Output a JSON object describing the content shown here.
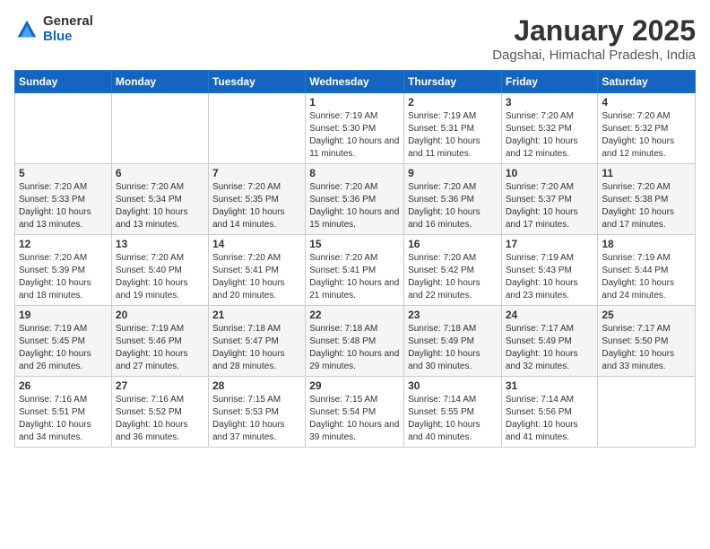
{
  "header": {
    "logo_general": "General",
    "logo_blue": "Blue",
    "title": "January 2025",
    "location": "Dagshai, Himachal Pradesh, India"
  },
  "days_of_week": [
    "Sunday",
    "Monday",
    "Tuesday",
    "Wednesday",
    "Thursday",
    "Friday",
    "Saturday"
  ],
  "weeks": [
    [
      {
        "day": "",
        "info": ""
      },
      {
        "day": "",
        "info": ""
      },
      {
        "day": "",
        "info": ""
      },
      {
        "day": "1",
        "info": "Sunrise: 7:19 AM\nSunset: 5:30 PM\nDaylight: 10 hours and 11 minutes."
      },
      {
        "day": "2",
        "info": "Sunrise: 7:19 AM\nSunset: 5:31 PM\nDaylight: 10 hours and 11 minutes."
      },
      {
        "day": "3",
        "info": "Sunrise: 7:20 AM\nSunset: 5:32 PM\nDaylight: 10 hours and 12 minutes."
      },
      {
        "day": "4",
        "info": "Sunrise: 7:20 AM\nSunset: 5:32 PM\nDaylight: 10 hours and 12 minutes."
      }
    ],
    [
      {
        "day": "5",
        "info": "Sunrise: 7:20 AM\nSunset: 5:33 PM\nDaylight: 10 hours and 13 minutes."
      },
      {
        "day": "6",
        "info": "Sunrise: 7:20 AM\nSunset: 5:34 PM\nDaylight: 10 hours and 13 minutes."
      },
      {
        "day": "7",
        "info": "Sunrise: 7:20 AM\nSunset: 5:35 PM\nDaylight: 10 hours and 14 minutes."
      },
      {
        "day": "8",
        "info": "Sunrise: 7:20 AM\nSunset: 5:36 PM\nDaylight: 10 hours and 15 minutes."
      },
      {
        "day": "9",
        "info": "Sunrise: 7:20 AM\nSunset: 5:36 PM\nDaylight: 10 hours and 16 minutes."
      },
      {
        "day": "10",
        "info": "Sunrise: 7:20 AM\nSunset: 5:37 PM\nDaylight: 10 hours and 17 minutes."
      },
      {
        "day": "11",
        "info": "Sunrise: 7:20 AM\nSunset: 5:38 PM\nDaylight: 10 hours and 17 minutes."
      }
    ],
    [
      {
        "day": "12",
        "info": "Sunrise: 7:20 AM\nSunset: 5:39 PM\nDaylight: 10 hours and 18 minutes."
      },
      {
        "day": "13",
        "info": "Sunrise: 7:20 AM\nSunset: 5:40 PM\nDaylight: 10 hours and 19 minutes."
      },
      {
        "day": "14",
        "info": "Sunrise: 7:20 AM\nSunset: 5:41 PM\nDaylight: 10 hours and 20 minutes."
      },
      {
        "day": "15",
        "info": "Sunrise: 7:20 AM\nSunset: 5:41 PM\nDaylight: 10 hours and 21 minutes."
      },
      {
        "day": "16",
        "info": "Sunrise: 7:20 AM\nSunset: 5:42 PM\nDaylight: 10 hours and 22 minutes."
      },
      {
        "day": "17",
        "info": "Sunrise: 7:19 AM\nSunset: 5:43 PM\nDaylight: 10 hours and 23 minutes."
      },
      {
        "day": "18",
        "info": "Sunrise: 7:19 AM\nSunset: 5:44 PM\nDaylight: 10 hours and 24 minutes."
      }
    ],
    [
      {
        "day": "19",
        "info": "Sunrise: 7:19 AM\nSunset: 5:45 PM\nDaylight: 10 hours and 26 minutes."
      },
      {
        "day": "20",
        "info": "Sunrise: 7:19 AM\nSunset: 5:46 PM\nDaylight: 10 hours and 27 minutes."
      },
      {
        "day": "21",
        "info": "Sunrise: 7:18 AM\nSunset: 5:47 PM\nDaylight: 10 hours and 28 minutes."
      },
      {
        "day": "22",
        "info": "Sunrise: 7:18 AM\nSunset: 5:48 PM\nDaylight: 10 hours and 29 minutes."
      },
      {
        "day": "23",
        "info": "Sunrise: 7:18 AM\nSunset: 5:49 PM\nDaylight: 10 hours and 30 minutes."
      },
      {
        "day": "24",
        "info": "Sunrise: 7:17 AM\nSunset: 5:49 PM\nDaylight: 10 hours and 32 minutes."
      },
      {
        "day": "25",
        "info": "Sunrise: 7:17 AM\nSunset: 5:50 PM\nDaylight: 10 hours and 33 minutes."
      }
    ],
    [
      {
        "day": "26",
        "info": "Sunrise: 7:16 AM\nSunset: 5:51 PM\nDaylight: 10 hours and 34 minutes."
      },
      {
        "day": "27",
        "info": "Sunrise: 7:16 AM\nSunset: 5:52 PM\nDaylight: 10 hours and 36 minutes."
      },
      {
        "day": "28",
        "info": "Sunrise: 7:15 AM\nSunset: 5:53 PM\nDaylight: 10 hours and 37 minutes."
      },
      {
        "day": "29",
        "info": "Sunrise: 7:15 AM\nSunset: 5:54 PM\nDaylight: 10 hours and 39 minutes."
      },
      {
        "day": "30",
        "info": "Sunrise: 7:14 AM\nSunset: 5:55 PM\nDaylight: 10 hours and 40 minutes."
      },
      {
        "day": "31",
        "info": "Sunrise: 7:14 AM\nSunset: 5:56 PM\nDaylight: 10 hours and 41 minutes."
      },
      {
        "day": "",
        "info": ""
      }
    ]
  ]
}
